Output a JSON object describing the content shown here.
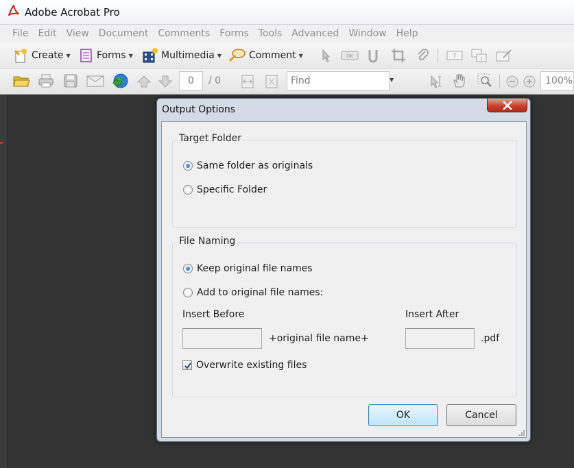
{
  "window": {
    "title": "Adobe Acrobat Pro"
  },
  "menu": [
    "File",
    "Edit",
    "View",
    "Document",
    "Comments",
    "Forms",
    "Tools",
    "Advanced",
    "Window",
    "Help"
  ],
  "toolbar": {
    "create": "Create",
    "forms": "Forms",
    "multimedia": "Multimedia",
    "comment": "Comment"
  },
  "nav": {
    "page_current": "0",
    "page_total": "/ 0",
    "find_placeholder": "Find",
    "zoom": "100%"
  },
  "dialog": {
    "title": "Output Options",
    "target_folder": {
      "legend": "Target Folder",
      "options": [
        {
          "label": "Same folder as originals",
          "checked": true
        },
        {
          "label": "Specific Folder",
          "checked": false
        }
      ]
    },
    "file_naming": {
      "legend": "File Naming",
      "options": [
        {
          "label": "Keep original file names",
          "checked": true
        },
        {
          "label": "Add to original file names:",
          "checked": false
        }
      ],
      "insert_before_label": "Insert Before",
      "insert_after_label": "Insert After",
      "middle_text": "+original file name+",
      "extension": ".pdf",
      "insert_before_value": "",
      "insert_after_value": "",
      "overwrite_label": "Overwrite existing files",
      "overwrite_checked": true
    },
    "ok_label": "OK",
    "cancel_label": "Cancel"
  },
  "colors": {
    "close_button": "#c8412c",
    "radio_dot": "#1a5fa8",
    "workspace": "#333333"
  }
}
